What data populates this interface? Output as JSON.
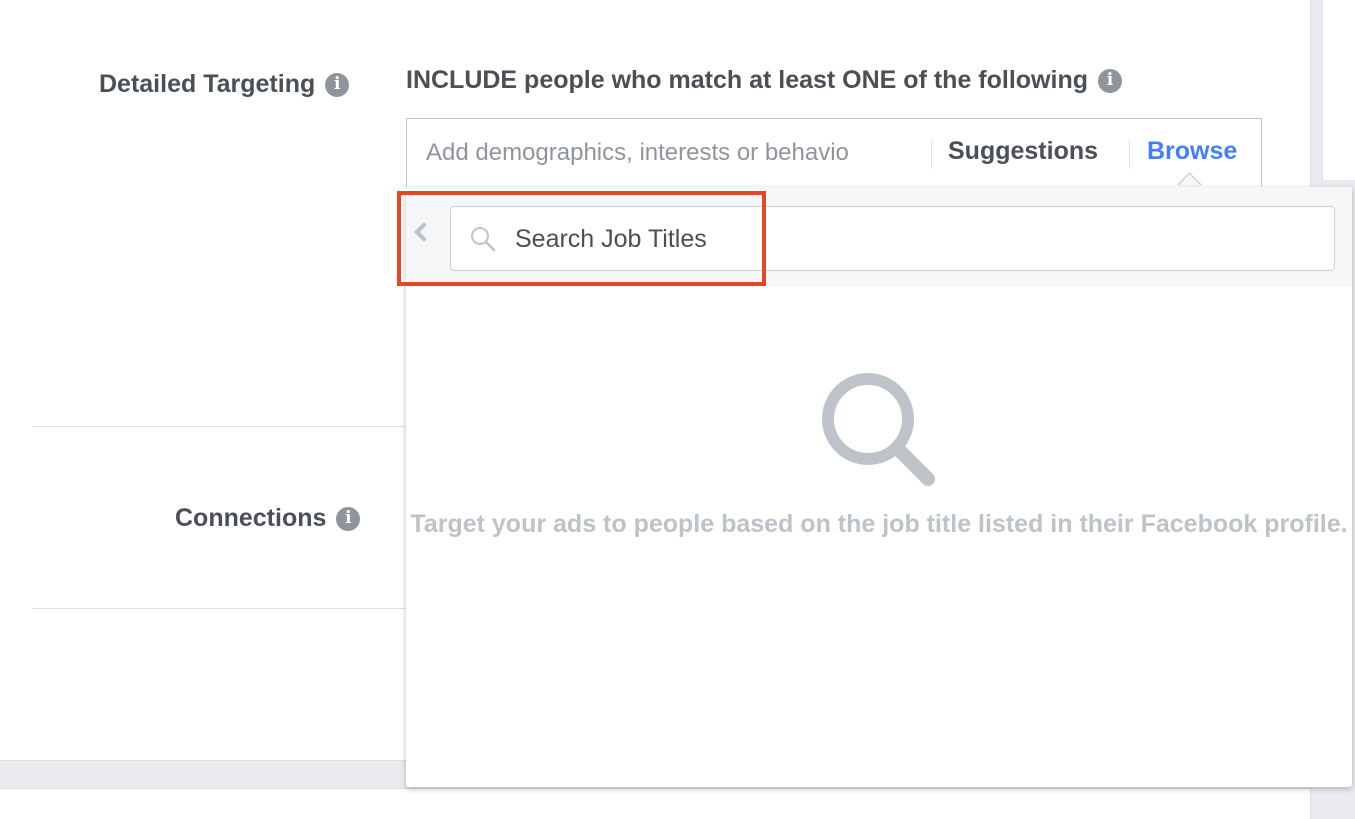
{
  "detailed_targeting": {
    "label": "Detailed Targeting",
    "include_text": "INCLUDE people who match at least ONE of the following",
    "input_placeholder": "Add demographics, interests or behavio",
    "suggestions_label": "Suggestions",
    "browse_label": "Browse"
  },
  "connections": {
    "label": "Connections"
  },
  "browse_panel": {
    "search_placeholder": "Search Job Titles",
    "empty_message": "Target your ads to people based on the job title listed in their Facebook profile."
  },
  "colors": {
    "link_blue": "#4080ff",
    "highlight_red": "#e4462a",
    "info_gray": "#90949c"
  }
}
